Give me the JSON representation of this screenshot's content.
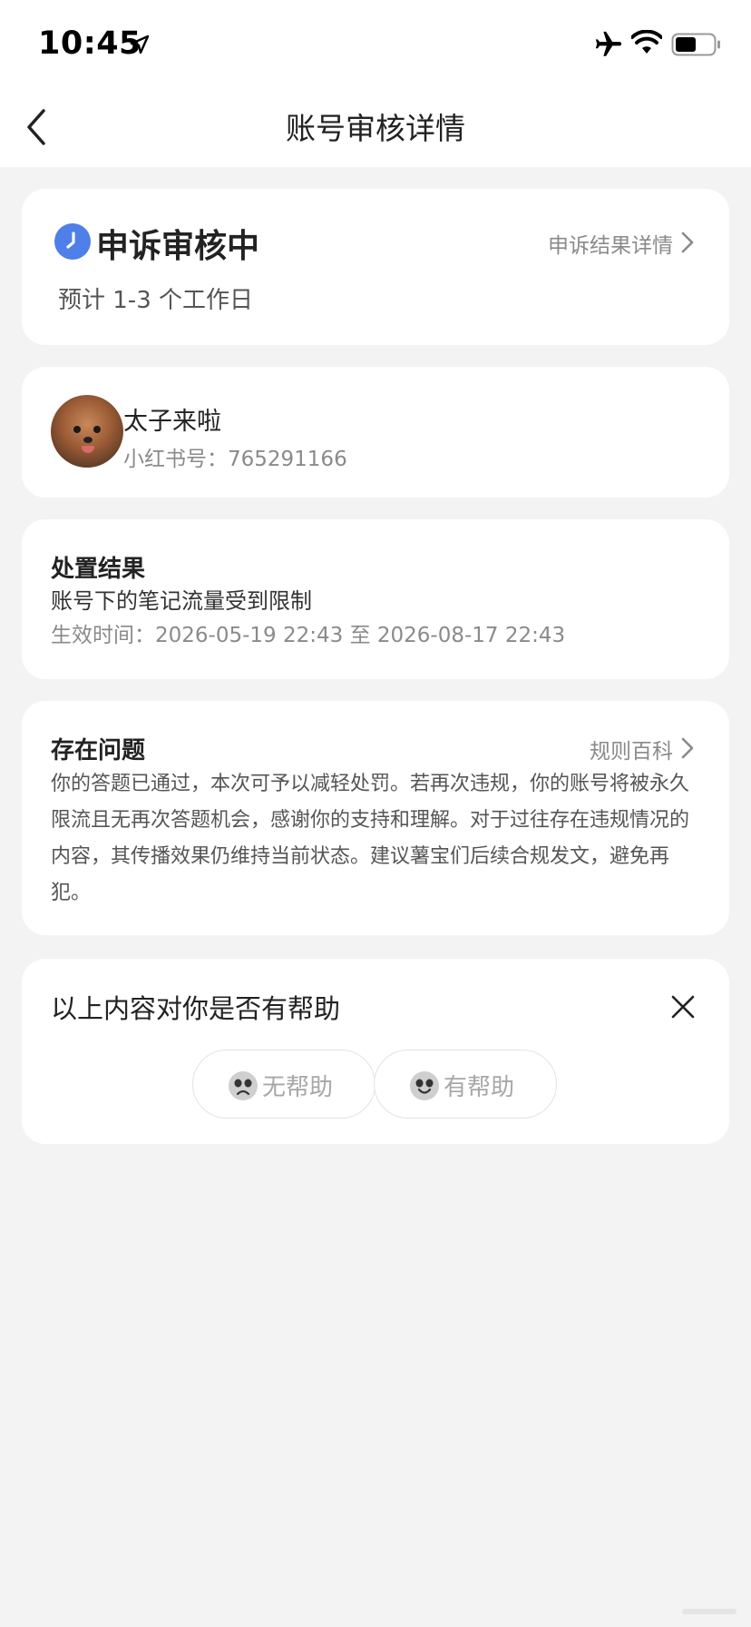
{
  "status_bar": {
    "time": "10:45"
  },
  "nav": {
    "title": "账号审核详情"
  },
  "appeal": {
    "status": "申诉审核中",
    "detail_link": "申诉结果详情",
    "estimate": "预计 1-3 个工作日"
  },
  "user": {
    "nickname": "太子来啦",
    "id_line": "小红书号：765291166"
  },
  "penalty": {
    "heading": "处置结果",
    "value": "账号下的笔记流量受到限制",
    "effective": "生效时间：2026-05-19 22:43 至 2026-08-17 22:43"
  },
  "issue": {
    "heading": "存在问题",
    "link": "规则百科",
    "text": "你的答题已通过，本次可予以减轻处罚。若再次违规，你的账号将被永久限流且无再次答题机会，感谢你的支持和理解。对于过往存在违规情况的内容，其传播效果仍维持当前状态。建议薯宝们后续合规发文，避免再犯。"
  },
  "feedback": {
    "question": "以上内容对你是否有帮助",
    "not_helpful": "无帮助",
    "helpful": "有帮助"
  },
  "colors": {
    "accent": "#4f7fe8",
    "background": "#f3f3f4",
    "muted_text": "#8a8a8a"
  },
  "icons": [
    "location-arrow-icon",
    "airplane-icon",
    "wifi-icon",
    "battery-icon",
    "back-chevron-icon",
    "clock-icon",
    "chevron-right-icon",
    "close-icon",
    "sad-face-icon",
    "happy-face-icon"
  ]
}
